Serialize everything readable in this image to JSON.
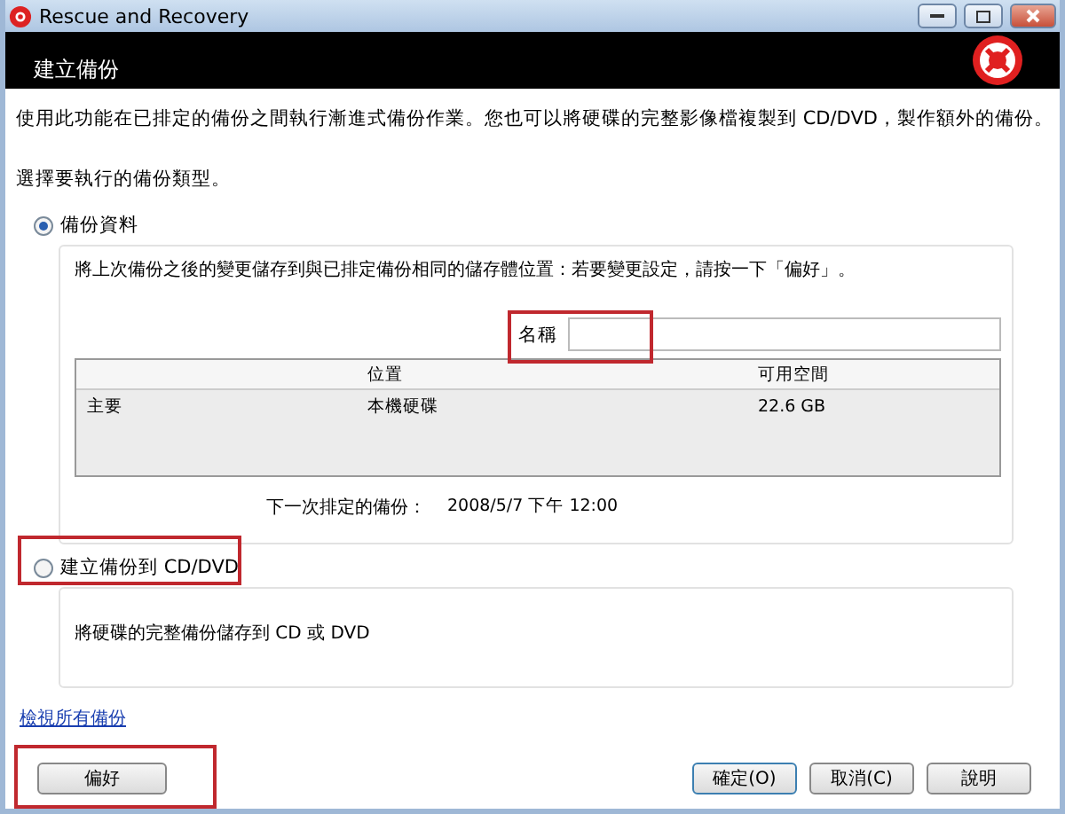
{
  "window": {
    "title": "Rescue and Recovery"
  },
  "header": {
    "title": "建立備份"
  },
  "intro": "使用此功能在已排定的備份之間執行漸進式備份作業。您也可以將硬碟的完整影像檔複製到 CD/DVD，製作額外的備份。",
  "prompt": "選擇要執行的備份類型。",
  "options": [
    {
      "label": "備份資料",
      "selected": true,
      "kind": "backup",
      "description": "將上次備份之後的變更儲存到與已排定備份相同的儲存體位置：若要變更設定，請按一下「偏好」。",
      "name_field": {
        "label": "名稱"
      },
      "table": {
        "columns": [
          "",
          "位置",
          "可用空間"
        ],
        "rows": [
          [
            "主要",
            "本機硬碟",
            "22.6 GB"
          ]
        ]
      },
      "next_backup": {
        "label": "下一次排定的備份：",
        "value": "2008/5/7 下午 12:00"
      }
    },
    {
      "label": "建立備份到 CD/DVD",
      "selected": false,
      "kind": "disc",
      "description": "將硬碟的完整備份儲存到 CD 或 DVD"
    }
  ],
  "link": "檢視所有備份",
  "buttons": {
    "left": [
      "偏好"
    ],
    "right": [
      "確定(O)",
      "取消(C)",
      "說明"
    ]
  }
}
